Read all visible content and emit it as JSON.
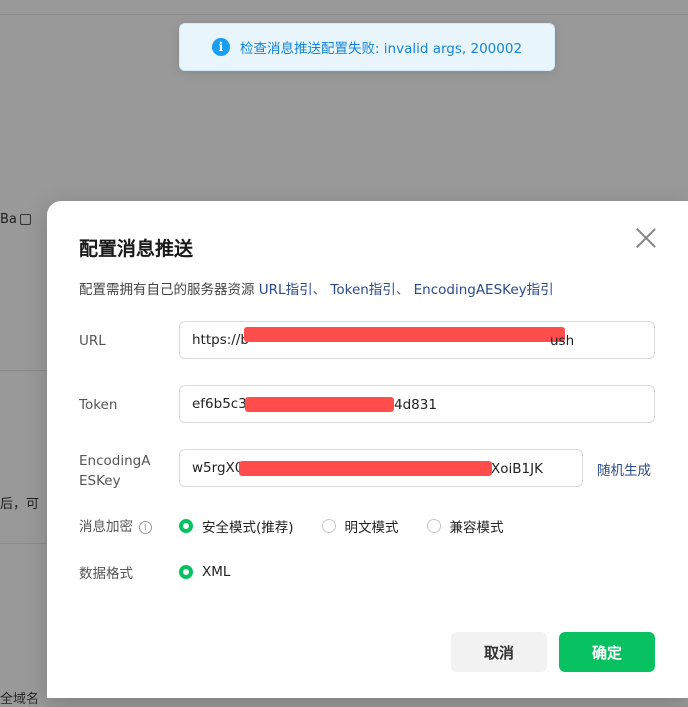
{
  "toast": {
    "message": "检查消息推送配置失败: invalid args, 200002"
  },
  "background": {
    "fragment_1": "Ba",
    "fragment_2": "后，可",
    "fragment_3": "全域名"
  },
  "dialog": {
    "title": "配置消息推送",
    "description_prefix": "配置需拥有自己的服务器资源",
    "links": [
      "URL指引",
      "Token指引",
      "EncodingAESKey指引"
    ],
    "separator": "、",
    "fields": {
      "url": {
        "label": "URL",
        "value": "https://b",
        "value_end": "ush"
      },
      "token": {
        "label": "Token",
        "value": "ef6b5c3",
        "value_end": "4d831"
      },
      "aeskey": {
        "label_line1": "EncodingA",
        "label_line2": "ESKey",
        "value": "w5rgX0",
        "value_end": "XoiB1JK",
        "generate_label": "随机生成"
      }
    },
    "encryption": {
      "label": "消息加密",
      "options": [
        "安全模式(推荐)",
        "明文模式",
        "兼容模式"
      ],
      "selected": "安全模式(推荐)"
    },
    "format": {
      "label": "数据格式",
      "options": [
        "XML"
      ],
      "selected": "XML"
    },
    "buttons": {
      "cancel": "取消",
      "confirm": "确定"
    }
  },
  "colors": {
    "accent": "#07c160",
    "link": "#2a4a8a",
    "toast_text": "#1585d8",
    "redaction": "#ff4d4d"
  }
}
